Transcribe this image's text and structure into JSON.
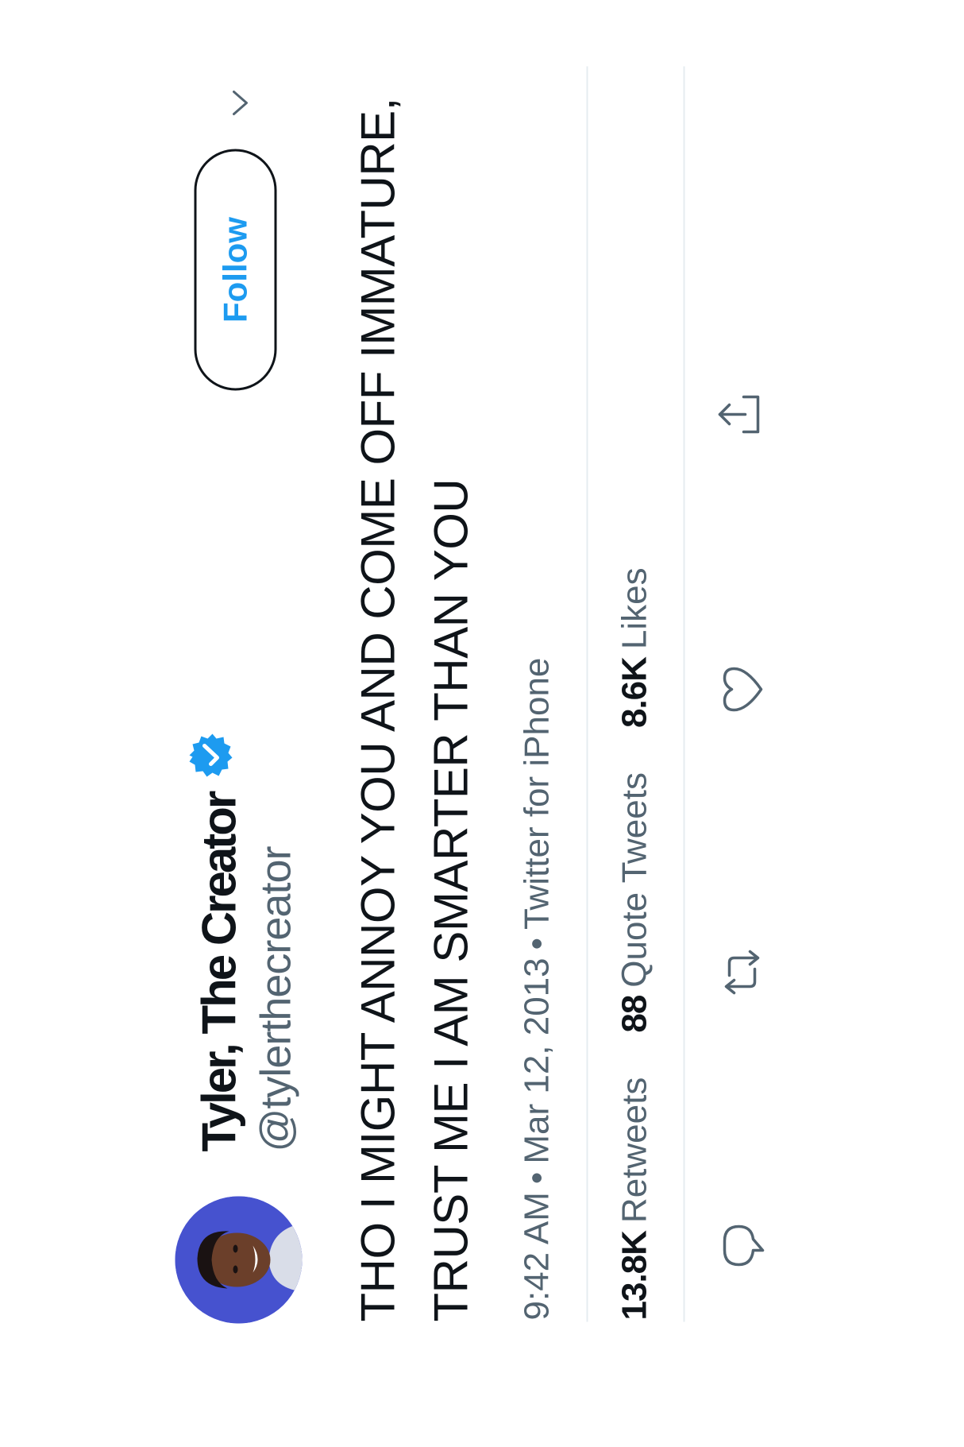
{
  "user": {
    "display_name": "Tyler, The Creator",
    "handle": "@tylerthecreator",
    "verified": true,
    "avatar_icon": "profile-photo"
  },
  "follow_button": {
    "label": "Follow"
  },
  "tweet": {
    "text": "THO I MIGHT ANNOY YOU AND COME OFF IMMATURE, TRUST ME I AM SMARTER THAN YOU",
    "time": "9:42 AM",
    "date": "Mar 12, 2013",
    "source": "Twitter for iPhone",
    "separator": "•"
  },
  "stats": {
    "retweets": {
      "value": "13.8K",
      "label": "Retweets"
    },
    "quote_tweets": {
      "value": "88",
      "label": "Quote Tweets"
    },
    "likes": {
      "value": "8.6K",
      "label": "Likes"
    }
  },
  "actions": [
    {
      "name": "reply",
      "icon": "speech-bubble-icon"
    },
    {
      "name": "retweet",
      "icon": "retweet-icon"
    },
    {
      "name": "like",
      "icon": "heart-icon"
    },
    {
      "name": "share",
      "icon": "share-icon"
    }
  ],
  "colors": {
    "text": "#0f1419",
    "secondary_text": "#536471",
    "accent": "#1d9bf0",
    "divider": "#e6ecf0",
    "icon": "#536471"
  }
}
